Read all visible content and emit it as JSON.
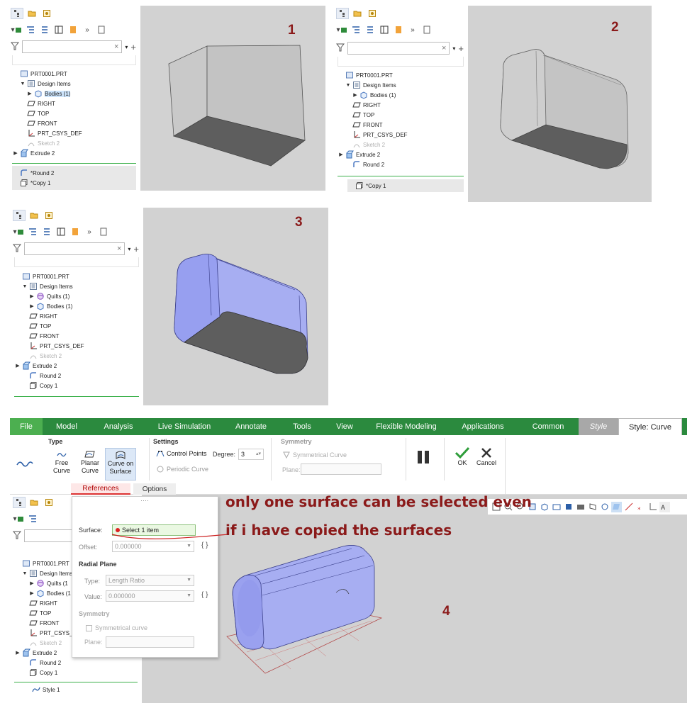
{
  "panels": [
    {
      "number": "1",
      "tree": [
        {
          "label": "PRT0001.PRT",
          "indent": 0,
          "arrow": "",
          "icon": "part-icon"
        },
        {
          "label": "Design Items",
          "indent": 1,
          "arrow": "▼",
          "icon": "design-items-icon"
        },
        {
          "label": "Bodies (1)",
          "indent": 2,
          "arrow": "▶",
          "icon": "bodies-icon",
          "selected": true
        },
        {
          "label": "RIGHT",
          "indent": 1,
          "arrow": "",
          "icon": "datum-plane-icon"
        },
        {
          "label": "TOP",
          "indent": 1,
          "arrow": "",
          "icon": "datum-plane-icon"
        },
        {
          "label": "FRONT",
          "indent": 1,
          "arrow": "",
          "icon": "datum-plane-icon"
        },
        {
          "label": "PRT_CSYS_DEF",
          "indent": 1,
          "arrow": "",
          "icon": "csys-icon"
        },
        {
          "label": "Sketch 2",
          "indent": 1,
          "arrow": "",
          "icon": "sketch-icon",
          "dim": true
        },
        {
          "label": "Extrude 2",
          "indent": 0,
          "arrow": "▶",
          "icon": "extrude-icon"
        }
      ],
      "after": [
        {
          "label": "Round 2",
          "prefix": "*",
          "icon": "round-icon"
        },
        {
          "label": "Copy 1",
          "prefix": "*",
          "icon": "copy-icon"
        }
      ]
    },
    {
      "number": "2",
      "tree": [
        {
          "label": "PRT0001.PRT",
          "indent": 0,
          "arrow": "",
          "icon": "part-icon"
        },
        {
          "label": "Design Items",
          "indent": 1,
          "arrow": "▼",
          "icon": "design-items-icon"
        },
        {
          "label": "Bodies (1)",
          "indent": 2,
          "arrow": "▶",
          "icon": "bodies-icon"
        },
        {
          "label": "RIGHT",
          "indent": 1,
          "arrow": "",
          "icon": "datum-plane-icon"
        },
        {
          "label": "TOP",
          "indent": 1,
          "arrow": "",
          "icon": "datum-plane-icon"
        },
        {
          "label": "FRONT",
          "indent": 1,
          "arrow": "",
          "icon": "datum-plane-icon"
        },
        {
          "label": "PRT_CSYS_DEF",
          "indent": 1,
          "arrow": "",
          "icon": "csys-icon"
        },
        {
          "label": "Sketch 2",
          "indent": 1,
          "arrow": "",
          "icon": "sketch-icon",
          "dim": true
        },
        {
          "label": "Extrude 2",
          "indent": 0,
          "arrow": "▶",
          "icon": "extrude-icon"
        },
        {
          "label": "Round 2",
          "indent": 1,
          "arrow": "",
          "icon": "round-icon"
        }
      ],
      "after": [
        {
          "label": "Copy 1",
          "prefix": "*",
          "icon": "copy-icon"
        }
      ]
    },
    {
      "number": "3",
      "tree": [
        {
          "label": "PRT0001.PRT",
          "indent": 0,
          "arrow": "",
          "icon": "part-icon"
        },
        {
          "label": "Design Items",
          "indent": 1,
          "arrow": "▼",
          "icon": "design-items-icon"
        },
        {
          "label": "Quilts (1)",
          "indent": 2,
          "arrow": "▶",
          "icon": "quilts-icon"
        },
        {
          "label": "Bodies (1)",
          "indent": 2,
          "arrow": "▶",
          "icon": "bodies-icon"
        },
        {
          "label": "RIGHT",
          "indent": 1,
          "arrow": "",
          "icon": "datum-plane-icon"
        },
        {
          "label": "TOP",
          "indent": 1,
          "arrow": "",
          "icon": "datum-plane-icon"
        },
        {
          "label": "FRONT",
          "indent": 1,
          "arrow": "",
          "icon": "datum-plane-icon"
        },
        {
          "label": "PRT_CSYS_DEF",
          "indent": 1,
          "arrow": "",
          "icon": "csys-icon"
        },
        {
          "label": "Sketch 2",
          "indent": 1,
          "arrow": "",
          "icon": "sketch-icon",
          "dim": true
        },
        {
          "label": "Extrude 2",
          "indent": 0,
          "arrow": "▶",
          "icon": "extrude-icon"
        },
        {
          "label": "Round 2",
          "indent": 1,
          "arrow": "",
          "icon": "round-icon"
        },
        {
          "label": "Copy 1",
          "indent": 1,
          "arrow": "",
          "icon": "copy-icon"
        }
      ],
      "after": []
    },
    {
      "number": "4",
      "tree": [
        {
          "label": "PRT0001.PRT",
          "indent": 0,
          "arrow": "",
          "icon": "part-icon"
        },
        {
          "label": "Design Items",
          "indent": 1,
          "arrow": "▼",
          "icon": "design-items-icon"
        },
        {
          "label": "Quilts (1",
          "indent": 2,
          "arrow": "▶",
          "icon": "quilts-icon"
        },
        {
          "label": "Bodies (1",
          "indent": 2,
          "arrow": "▶",
          "icon": "bodies-icon"
        },
        {
          "label": "RIGHT",
          "indent": 1,
          "arrow": "",
          "icon": "datum-plane-icon"
        },
        {
          "label": "TOP",
          "indent": 1,
          "arrow": "",
          "icon": "datum-plane-icon"
        },
        {
          "label": "FRONT",
          "indent": 1,
          "arrow": "",
          "icon": "datum-plane-icon"
        },
        {
          "label": "PRT_CSYS_DE",
          "indent": 1,
          "arrow": "",
          "icon": "csys-icon"
        },
        {
          "label": "Sketch 2",
          "indent": 1,
          "arrow": "",
          "icon": "sketch-icon",
          "dim": true
        },
        {
          "label": "Extrude 2",
          "indent": 0,
          "arrow": "▶",
          "icon": "extrude-icon"
        },
        {
          "label": "Round 2",
          "indent": 1,
          "arrow": "",
          "icon": "round-icon"
        },
        {
          "label": "Copy 1",
          "indent": 1,
          "arrow": "",
          "icon": "copy-icon"
        }
      ],
      "after": [
        {
          "label": "Style 1",
          "prefix": "",
          "icon": "style-icon"
        }
      ]
    }
  ],
  "ribbon": {
    "tabs": [
      "File",
      "Model",
      "Analysis",
      "Live Simulation",
      "Annotate",
      "Tools",
      "View",
      "Flexible Modeling",
      "Applications",
      "Common",
      "Style",
      "Style: Curve"
    ],
    "groups": {
      "type": {
        "title": "Type",
        "free": "Free\nCurve",
        "planar": "Planar\nCurve",
        "cos": "Curve on\nSurface"
      },
      "settings": {
        "title": "Settings",
        "control_points": "Control Points",
        "degree_label": "Degree:",
        "degree_value": "3",
        "periodic": "Periodic Curve"
      },
      "symmetry": {
        "title": "Symmetry",
        "symmetrical": "Symmetrical Curve",
        "plane_label": "Plane:"
      },
      "ok": "OK",
      "cancel": "Cancel"
    },
    "subtabs": [
      "References",
      "Options"
    ]
  },
  "dialog": {
    "surface_label": "Surface:",
    "surface_value": "Select 1 item",
    "offset_label": "Offset:",
    "offset_value": "0.000000",
    "radial_title": "Radial Plane",
    "type_label": "Type:",
    "type_value": "Length Ratio",
    "value_label": "Value:",
    "value_value": "0.000000",
    "sym_title": "Symmetry",
    "sym_check": "Symmetrical curve",
    "plane_label": "Plane:",
    "braces": "{ }"
  },
  "annotation": {
    "line1": "only one surface can be selected even",
    "line2": "if i have copied the surfaces"
  },
  "colors": {
    "ribbon_green": "#2b8a3e",
    "annotation_red": "#8b1a1a",
    "viewport_gray": "#d2d2d2",
    "surface_blue": "#a7aef2"
  }
}
